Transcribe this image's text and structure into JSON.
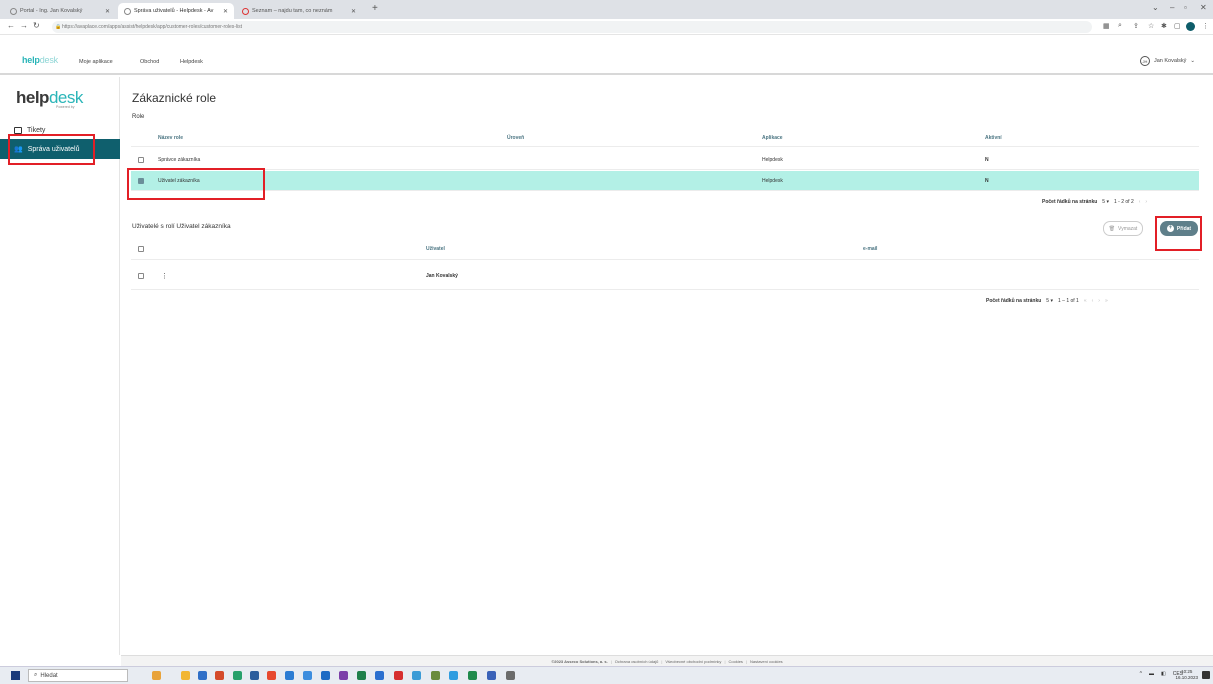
{
  "browser": {
    "tabs": [
      {
        "label": "Portal - Ing. Jan Kovalský"
      },
      {
        "label": "Správa uživatelů - Helpdesk - Av"
      },
      {
        "label": "Seznam – najdu tam, co neznám"
      }
    ],
    "url": "https://avaplace.com/apps/assist/helpdesk/app/customer-roles/customer-roles-list"
  },
  "app_header": {
    "logo_main": "help",
    "logo_accent": "desk",
    "nav": [
      "Moje aplikace",
      "Obchod",
      "Helpdesk"
    ],
    "avatar_initials": "JH",
    "user_name": "Jan Kovalský"
  },
  "sidebar": {
    "brand_main": "help",
    "brand_accent": "desk",
    "brand_sub": "Powered by",
    "items": [
      {
        "label": "Tikety"
      },
      {
        "label": "Správa uživatelů"
      }
    ]
  },
  "roles_section": {
    "page_title": "Zákaznické role",
    "label": "Role",
    "columns": [
      "Název role",
      "Úroveň",
      "Aplikace",
      "Aktivní"
    ],
    "rows": [
      {
        "name": "Správce zákazníka",
        "level": "",
        "app": "Helpdesk",
        "active": "N",
        "checked": false
      },
      {
        "name": "Uživatel zákazníka",
        "level": "",
        "app": "Helpdesk",
        "active": "N",
        "checked": true
      }
    ],
    "pager": {
      "label": "Počet řádků na stránku",
      "per_page": "5",
      "range": "1 - 2 of 2"
    }
  },
  "users_section": {
    "title": "Uživatelé s rolí Uživatel zákazníka",
    "remove_label": "Vymazat",
    "add_label": "Přidat",
    "columns": [
      "Uživatel",
      "e-mail"
    ],
    "rows": [
      {
        "user": "Jan Kovalský",
        "email": ""
      }
    ],
    "pager": {
      "label": "Počet řádků na stránku",
      "per_page": "5",
      "range": "1 – 1 of 1"
    }
  },
  "footer": {
    "copyright": "©2023 Asseco Solutions, a. s.",
    "links": [
      "Ochrana osobních údajů",
      "Všeobecné obchodní podmínky",
      "Cookies",
      "Nastavení cookies"
    ]
  },
  "taskbar": {
    "search_label": "Hledat",
    "lang": "CES",
    "time": "10:25",
    "date": "16.10.2023"
  },
  "colors": {
    "accent": "#2ab5b8",
    "sidebar_active": "#0f5f6d",
    "selected_row": "#b3f0e6",
    "highlight_box": "#e21f26"
  }
}
